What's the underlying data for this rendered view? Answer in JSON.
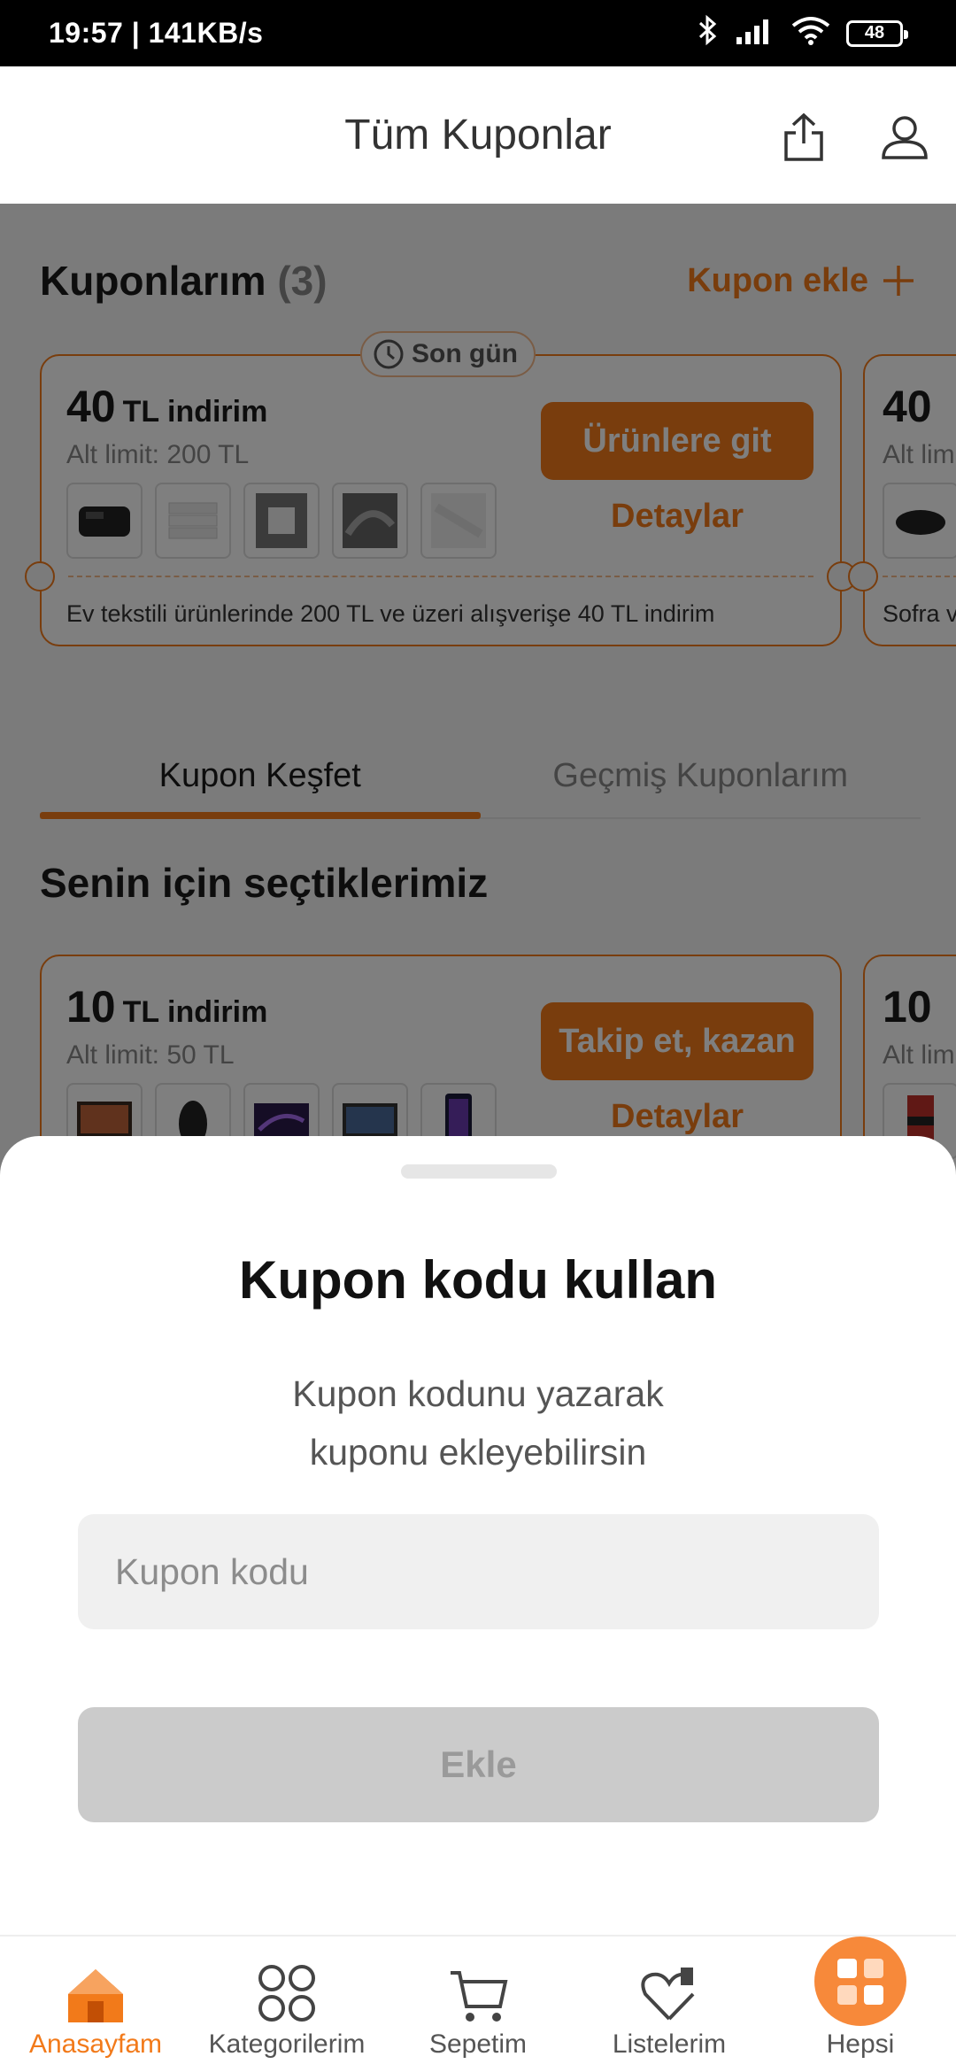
{
  "status_bar": {
    "time": "19:57 | 141KB/s",
    "battery": "48"
  },
  "header": {
    "title": "Tüm Kuponlar",
    "share_icon": "share-icon",
    "profile_icon": "user-icon"
  },
  "my_coupons": {
    "title": "Kuponlarım",
    "count": "(3)",
    "add_label": "Kupon ekle",
    "cards": [
      {
        "badge": "Son gün",
        "amount": "40",
        "amount_text": "TL indirim",
        "limit": "Alt limit: 200 TL",
        "cta": "Ürünlere git",
        "details": "Detaylar",
        "description": "Ev tekstili ürünlerinde 200 TL ve üzeri alışverişe 40 TL indirim"
      },
      {
        "amount": "40",
        "limit": "Alt lim",
        "description": "Sofra v"
      }
    ]
  },
  "tabs": [
    {
      "label": "Kupon Keşfet",
      "active": true
    },
    {
      "label": "Geçmiş Kuponlarım",
      "active": false
    }
  ],
  "recommended": {
    "title": "Senin için seçtiklerimiz",
    "cards": [
      {
        "amount": "10",
        "amount_text": "TL indirim",
        "limit": "Alt limit: 50 TL",
        "cta": "Takip et, kazan",
        "details": "Detaylar"
      },
      {
        "amount": "10",
        "limit": "Alt lim"
      }
    ]
  },
  "sheet": {
    "title": "Kupon kodu kullan",
    "subtitle_line1": "Kupon kodunu yazarak",
    "subtitle_line2": "kuponu ekleyebilirsin",
    "input_placeholder": "Kupon kodu",
    "button_label": "Ekle"
  },
  "bottom_nav": [
    {
      "label": "Anasayfam",
      "icon": "home-icon",
      "active": true
    },
    {
      "label": "Kategorilerim",
      "icon": "categories-icon",
      "active": false
    },
    {
      "label": "Sepetim",
      "icon": "cart-icon",
      "active": false
    },
    {
      "label": "Listelerim",
      "icon": "heart-list-icon",
      "active": false
    },
    {
      "label": "Hepsi",
      "icon": "all-grid-icon",
      "active": false
    }
  ],
  "colors": {
    "accent": "#f27a1a",
    "disabled": "#cbcbcb",
    "overlay": "rgba(0,0,0,0.5)"
  }
}
